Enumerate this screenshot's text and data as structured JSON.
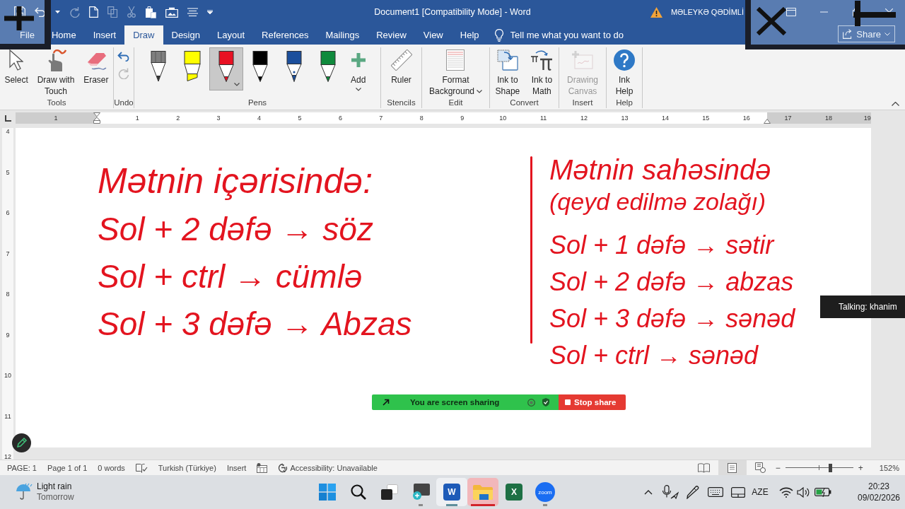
{
  "title_bar": {
    "quick_access": [
      {
        "kind": "save",
        "disabled": false
      },
      {
        "kind": "undo",
        "disabled": false
      },
      {
        "kind": "dropdown",
        "disabled": false
      },
      {
        "kind": "redo",
        "disabled": true
      },
      {
        "kind": "new",
        "disabled": false
      },
      {
        "kind": "copy",
        "disabled": true
      },
      {
        "kind": "cut",
        "disabled": true
      },
      {
        "kind": "paste",
        "disabled": false
      },
      {
        "kind": "screenshot",
        "disabled": false
      },
      {
        "kind": "align",
        "disabled": false
      },
      {
        "kind": "customize",
        "disabled": false
      }
    ],
    "title": "Document1 [Compatibility Mode] - Word",
    "user": "MƏLEYKƏ QƏDİMLİ",
    "controls": [
      {
        "kind": "display"
      },
      {
        "kind": "minimize"
      },
      {
        "kind": "restore"
      },
      {
        "kind": "close"
      }
    ]
  },
  "tabs": [
    {
      "label": "File",
      "selected": false
    },
    {
      "label": "Home",
      "selected": false
    },
    {
      "label": "Insert",
      "selected": false
    },
    {
      "label": "Draw",
      "selected": true
    },
    {
      "label": "Design",
      "selected": false
    },
    {
      "label": "Layout",
      "selected": false
    },
    {
      "label": "References",
      "selected": false
    },
    {
      "label": "Mailings",
      "selected": false
    },
    {
      "label": "Review",
      "selected": false
    },
    {
      "label": "View",
      "selected": false
    },
    {
      "label": "Help",
      "selected": false
    }
  ],
  "tell_me": {
    "placeholder": "Tell me what you want to do"
  },
  "share_button": {
    "label": "Share"
  },
  "ribbon": {
    "groups": [
      {
        "kind": "tools",
        "label": "Tools",
        "buttons": [
          {
            "kind": "select",
            "label": "Select",
            "disabled": false,
            "dropdown": false
          },
          {
            "kind": "touch",
            "label": "Draw with\nTouch",
            "disabled": false,
            "dropdown": false
          },
          {
            "kind": "eraser",
            "label": "Eraser",
            "disabled": false,
            "dropdown": false
          }
        ]
      },
      {
        "kind": "undo",
        "label": "Undo",
        "actions": [
          {
            "kind": "undo",
            "disabled": false
          },
          {
            "kind": "redo",
            "disabled": true
          }
        ]
      },
      {
        "kind": "pens",
        "label": "Pens",
        "pens": [
          {
            "kind": "pencil",
            "color": "#7f7f7f",
            "selected": false
          },
          {
            "kind": "highlighter",
            "color": "#ffff00",
            "selected": false
          },
          {
            "kind": "pen",
            "color": "#e81123",
            "selected": true
          },
          {
            "kind": "pen",
            "color": "#000000",
            "selected": false
          },
          {
            "kind": "fountain",
            "color": "#1c4f9c",
            "selected": false
          },
          {
            "kind": "pen",
            "color": "#0f8a3c",
            "selected": false
          }
        ],
        "add": {
          "label": "Add"
        }
      },
      {
        "kind": "stencils",
        "label": "Stencils",
        "buttons": [
          {
            "kind": "ruler",
            "label": "Ruler",
            "disabled": false,
            "dropdown": false
          }
        ]
      },
      {
        "kind": "edit",
        "label": "Edit",
        "buttons": [
          {
            "kind": "background",
            "label": "Format\nBackground",
            "disabled": false,
            "dropdown": true
          }
        ]
      },
      {
        "kind": "convert",
        "label": "Convert",
        "buttons": [
          {
            "kind": "shape",
            "label": "Ink to\nShape",
            "disabled": false,
            "dropdown": false
          },
          {
            "kind": "math",
            "label": "Ink to\nMath",
            "disabled": false,
            "dropdown": false
          }
        ]
      },
      {
        "kind": "insert",
        "label": "Insert",
        "buttons": [
          {
            "kind": "canvas",
            "label": "Drawing\nCanvas",
            "disabled": true,
            "dropdown": false
          }
        ]
      },
      {
        "kind": "help",
        "label": "Help",
        "buttons": [
          {
            "kind": "help",
            "label": "Ink\nHelp",
            "disabled": false,
            "dropdown": false
          }
        ]
      }
    ]
  },
  "ruler": {
    "left_margin_labels": [
      "1"
    ],
    "body_labels": [
      "1",
      "2",
      "3",
      "4",
      "5",
      "6",
      "7",
      "8",
      "9",
      "10",
      "11",
      "12",
      "13",
      "14",
      "15",
      "16"
    ],
    "right_margin_labels": [
      "17",
      "18",
      "19"
    ]
  },
  "vertical_ruler": {
    "labels": [
      "4",
      "5",
      "6",
      "7",
      "8",
      "9",
      "10",
      "11",
      "12"
    ]
  },
  "ink": {
    "left": {
      "heading": "Mətnin içərisində:",
      "lines": [
        "Sol + 2 dəfə → söz",
        "Sol + ctrl → cümlə",
        "Sol + 3 dəfə → Abzas"
      ]
    },
    "right": {
      "heading": "Mətnin sahəsində",
      "subheading": "(qeyd edilmə zolağı)",
      "lines": [
        "Sol + 1 dəfə → sətir",
        "Sol + 2 dəfə → abzas",
        "Sol + 3 dəfə → sənəd",
        "Sol + ctrl → sənəd"
      ]
    }
  },
  "status_bar": {
    "items": [
      {
        "kind": "text",
        "label": "PAGE: 1"
      },
      {
        "kind": "text",
        "label": "Page 1 of 1"
      },
      {
        "kind": "text",
        "label": "0 words"
      },
      {
        "kind": "proofing"
      },
      {
        "kind": "text",
        "label": "Turkish (Türkiye)"
      },
      {
        "kind": "text",
        "label": "Insert"
      },
      {
        "kind": "macro"
      },
      {
        "kind": "accessibility",
        "label": "Accessibility: Unavailable"
      }
    ],
    "views": [
      {
        "kind": "read",
        "selected": false
      },
      {
        "kind": "print",
        "selected": true
      },
      {
        "kind": "web",
        "selected": false
      }
    ],
    "zoom": {
      "minus": "−",
      "plus": "+",
      "level": 0.66,
      "reading": "152%"
    }
  },
  "taskbar": {
    "weather": {
      "condition": "Light rain",
      "when": "Tomorrow"
    },
    "apps": [
      {
        "kind": "start",
        "active": false,
        "running": false,
        "attention": false
      },
      {
        "kind": "search",
        "active": false,
        "running": false,
        "attention": false
      },
      {
        "kind": "taskview",
        "active": false,
        "running": false,
        "attention": false
      },
      {
        "kind": "magnifier",
        "active": false,
        "running": true,
        "attention": false
      },
      {
        "kind": "word",
        "letter": "W",
        "active": true,
        "running": true,
        "attention": false
      },
      {
        "kind": "explorer",
        "active": false,
        "running": true,
        "attention": true
      },
      {
        "kind": "excel",
        "letter": "X",
        "active": false,
        "running": false,
        "attention": false
      },
      {
        "kind": "zoom",
        "letter": "zoom",
        "active": false,
        "running": true,
        "attention": false
      }
    ],
    "tray": [
      {
        "kind": "chevron"
      },
      {
        "kind": "mic"
      },
      {
        "kind": "pen"
      },
      {
        "kind": "keyboard"
      },
      {
        "kind": "touchpad"
      },
      {
        "kind": "language",
        "label": "AZE"
      },
      {
        "kind": "wifi"
      },
      {
        "kind": "volume"
      },
      {
        "kind": "battery"
      }
    ],
    "clock": {
      "time": "20:23",
      "date": "09/02/2026"
    }
  },
  "screen_share": {
    "message": "You are screen sharing",
    "stop_label": "Stop share"
  },
  "speaker": {
    "label": "Talking: khanim"
  }
}
